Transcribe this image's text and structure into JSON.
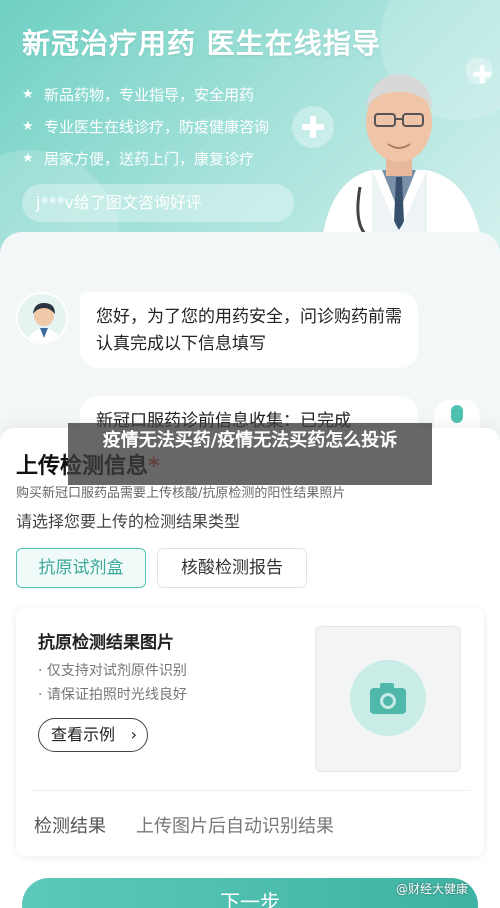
{
  "banner": {
    "title": "新冠治疗用药 医生在线指导",
    "items": [
      {
        "icon": "star-icon",
        "label": "新品药物，专业指导，安全用药"
      },
      {
        "icon": "star-icon",
        "label": "专业医生在线诊疗，防疫健康咨询"
      },
      {
        "icon": "star-icon",
        "label": "居家方便，送药上门，康复诊疗"
      }
    ],
    "review": "j***v给了图文咨询好评"
  },
  "chat": {
    "message_1": "您好，为了您的用药安全，问诊购药前需认真完成以下信息填写",
    "message_2": "新冠口服药诊前信息收集：已完成"
  },
  "panel": {
    "title": "上传检测信息",
    "required_mark": "*",
    "description": "购买新冠口服药品需要上传核酸/抗原检测的阳性结果照片",
    "prompt": "请选择您要上传的检测结果类型",
    "tabs": [
      {
        "label": "抗原试剂盒",
        "active": true
      },
      {
        "label": "核酸检测报告",
        "active": false
      }
    ],
    "card": {
      "title": "抗原检测结果图片",
      "tips": [
        "· 仅支持对试剂原件识别",
        "· 请保证拍照时光线良好"
      ],
      "example_label": "查看示例",
      "example_icon": "chevron-right-icon",
      "upload_icon": "camera-icon"
    },
    "result_label": "检测结果",
    "result_value": "上传图片后自动识别结果",
    "next_label": "下一步"
  },
  "overlay": {
    "headline": "疫情无法买药/疫情无法买药怎么投诉",
    "watermark": "@财经大健康"
  },
  "colors": {
    "accent": "#4fc1b1",
    "required": "#e5483e"
  }
}
